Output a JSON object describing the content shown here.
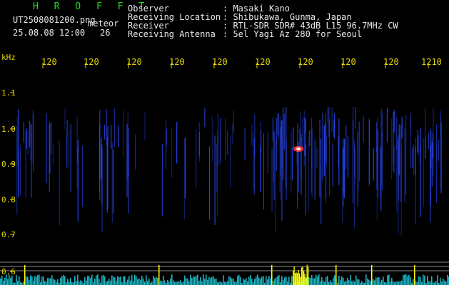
{
  "header": {
    "brand": "H R O F F T",
    "file_name": "UT2508081200.png",
    "file_tag": "meteor",
    "date_time": "25.08.08 12:00",
    "count": "26"
  },
  "station": {
    "labels": [
      "Observer",
      "Receiving Location",
      "Receiver",
      "Receiving Antenna"
    ],
    "values": [
      ": Masaki Kano",
      ": Shibukawa, Gunma, Japan",
      ": RTL-SDR SDR# 43dB L15 96.7MHz CW",
      ": 5el Yagi Az 280 for Seoul"
    ]
  },
  "axis": {
    "unit": "kHz",
    "y_ticks": [
      "1.1",
      "1.0",
      "0.9",
      "0.8",
      "0.7",
      "0.6"
    ],
    "x_ticks": [
      "120",
      "120",
      "120",
      "120",
      "120",
      "120",
      "120",
      "120",
      "120",
      "1210"
    ]
  },
  "colors": {
    "background": "#000000",
    "title_green": "#22dd22",
    "text_white": "#e8e8e8",
    "axis_yellow": "#e8d800",
    "signal_blue": "#2a4cff",
    "spike_cyan": "#20e0f0",
    "spike_yellow": "#ffff00"
  }
}
